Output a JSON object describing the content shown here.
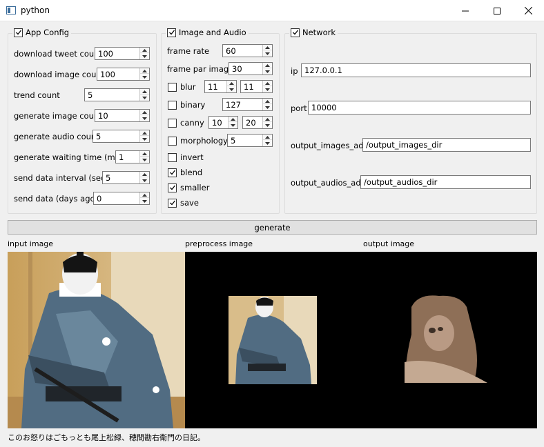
{
  "window": {
    "title": "python",
    "icons": {
      "app": "python-app-icon",
      "minimize": "minimize-icon",
      "maximize": "maximize-icon",
      "close": "close-icon"
    }
  },
  "app_config": {
    "title": "App Config",
    "enabled": true,
    "fields": [
      {
        "label": "download tweet count",
        "value": "100"
      },
      {
        "label": "download image count",
        "value": "100"
      },
      {
        "label": "trend count",
        "value": "5"
      },
      {
        "label": "generate image count",
        "value": "10"
      },
      {
        "label": "generate audio count",
        "value": "5"
      },
      {
        "label": "generate waiting time (min)",
        "value": "1"
      },
      {
        "label": "send data interval (sec)",
        "value": "5"
      },
      {
        "label": "send data (days ago)",
        "value": "0"
      }
    ]
  },
  "image_audio": {
    "title": "Image and Audio",
    "enabled": true,
    "frame_rate": {
      "label": "frame rate",
      "value": "60"
    },
    "frame_per_image": {
      "label": "frame par image",
      "value": "30"
    },
    "blur": {
      "label": "blur",
      "checked": false,
      "value1": "11",
      "value2": "11"
    },
    "binary": {
      "label": "binary",
      "checked": false,
      "value": "127"
    },
    "canny": {
      "label": "canny",
      "checked": false,
      "value1": "10",
      "value2": "20"
    },
    "morphology": {
      "label": "morphology",
      "checked": false,
      "value": "5"
    },
    "invert": {
      "label": "invert",
      "checked": false
    },
    "blend": {
      "label": "blend",
      "checked": true
    },
    "smaller": {
      "label": "smaller",
      "checked": true
    },
    "save": {
      "label": "save",
      "checked": true
    }
  },
  "network": {
    "title": "Network",
    "enabled": true,
    "ip": {
      "label": "ip",
      "value": "127.0.0.1"
    },
    "port": {
      "label": "port",
      "value": "10000"
    },
    "output_images_addr": {
      "label": "output_images_addr",
      "value": "/output_images_dir"
    },
    "output_audios_addr": {
      "label": "output_audios_addr",
      "value": "/output_audios_dir"
    }
  },
  "generate_button": "generate",
  "images": {
    "input_label": "input image",
    "preprocess_label": "preprocess image",
    "output_label": "output image"
  },
  "caption": "このお怒りはごもっとも尾上松緑、穂間勘右衛門の日記。"
}
